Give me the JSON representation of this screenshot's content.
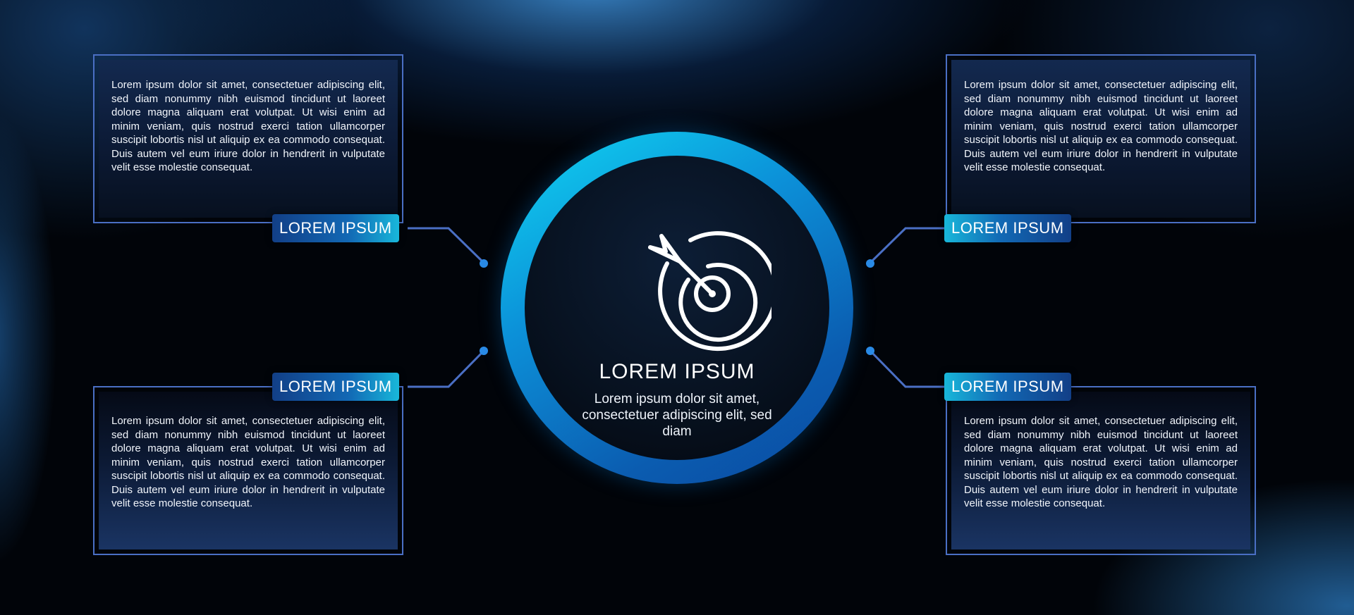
{
  "center": {
    "title": "LOREM IPSUM",
    "description": "Lorem ipsum dolor sit amet, consectetuer adipiscing elit, sed diam",
    "icon": "target-arrow-icon"
  },
  "blocks": [
    {
      "label": "LOREM IPSUM",
      "text": "Lorem ipsum dolor sit amet, consectetuer adipiscing elit, sed diam nonummy nibh euismod tincidunt ut laoreet dolore magna aliquam erat volutpat. Ut wisi enim ad minim veniam, quis nostrud exerci tation ullamcorper suscipit lobortis nisl ut aliquip ex ea commodo consequat. Duis autem vel eum iriure dolor in hendrerit in vulputate velit esse molestie consequat."
    },
    {
      "label": "LOREM IPSUM",
      "text": "Lorem ipsum dolor sit amet, consectetuer adipiscing elit, sed diam nonummy nibh euismod tincidunt ut laoreet dolore magna aliquam erat volutpat. Ut wisi enim ad minim veniam, quis nostrud exerci tation ullamcorper suscipit lobortis nisl ut aliquip ex ea commodo consequat. Duis autem vel eum iriure dolor in hendrerit in vulputate velit esse molestie consequat."
    },
    {
      "label": "LOREM IPSUM",
      "text": "Lorem ipsum dolor sit amet, consectetuer adipiscing elit, sed diam nonummy nibh euismod tincidunt ut laoreet dolore magna aliquam erat volutpat. Ut wisi enim ad minim veniam, quis nostrud exerci tation ullamcorper suscipit lobortis nisl ut aliquip ex ea commodo consequat. Duis autem vel eum iriure dolor in hendrerit in vulputate velit esse molestie consequat."
    },
    {
      "label": "LOREM IPSUM",
      "text": "Lorem ipsum dolor sit amet, consectetuer adipiscing elit, sed diam nonummy nibh euismod tincidunt ut laoreet dolore magna aliquam erat volutpat. Ut wisi enim ad minim veniam, quis nostrud exerci tation ullamcorper suscipit lobortis nisl ut aliquip ex ea commodo consequat. Duis autem vel eum iriure dolor in hendrerit in vulputate velit esse molestie consequat."
    }
  ],
  "colors": {
    "background": "#010409",
    "ring_light": "#0fd6f2",
    "ring_dark": "#0a49a0",
    "box_border": "#4a6fc4",
    "connector": "#4a6fc4",
    "tag_cyan": "#18b7da",
    "tag_blue": "#123f87",
    "text": "#ffffff"
  }
}
